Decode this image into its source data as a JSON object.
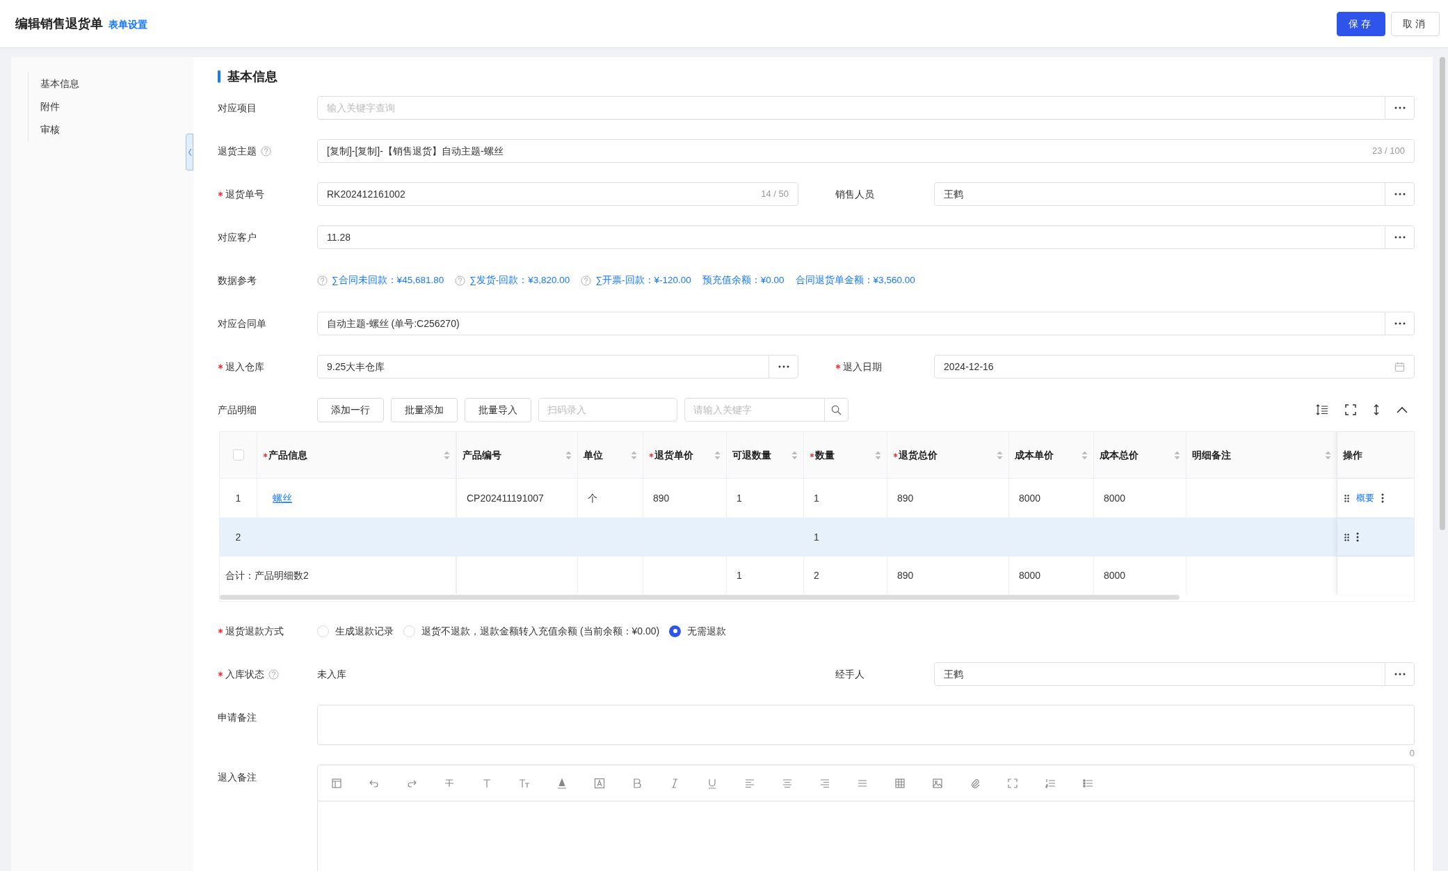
{
  "header": {
    "title": "编辑销售退货单",
    "settings_link": "表单设置",
    "buttons": [
      {
        "label": "保存",
        "kind": "primary"
      },
      {
        "label": "取消",
        "kind": "default"
      }
    ]
  },
  "sidebar": {
    "items": [
      {
        "label": "基本信息"
      },
      {
        "label": "附件"
      },
      {
        "label": "审核"
      }
    ]
  },
  "section": {
    "title": "基本信息"
  },
  "rows": [
    {
      "kind": "picker",
      "label": "对应项目",
      "required": false,
      "help": false,
      "placeholder": "输入关键字查询"
    },
    {
      "kind": "text",
      "label": "退货主题",
      "required": false,
      "help": true,
      "value": "[复制]-[复制]-【销售退货】自动主题-螺丝",
      "counter": "23 / 100"
    },
    {
      "kind": "pair",
      "fields": [
        {
          "kind": "text",
          "label": "退货单号",
          "required": true,
          "help": false,
          "value": "RK202412161002",
          "counter": "14 / 50"
        },
        {
          "kind": "picker",
          "label": "销售人员",
          "required": false,
          "help": false,
          "value": "王鹤"
        }
      ]
    },
    {
      "kind": "picker",
      "label": "对应客户",
      "required": false,
      "help": false,
      "value": "11.28"
    },
    {
      "kind": "refs",
      "label": "数据参考",
      "required": false,
      "help": false,
      "items": [
        {
          "help": true,
          "text": "∑合同未回款：¥45,681.80"
        },
        {
          "help": true,
          "text": "∑发货-回款：¥3,820.00"
        },
        {
          "help": true,
          "text": "∑开票-回款：¥-120.00"
        },
        {
          "help": false,
          "text": "预充值余额：¥0.00"
        },
        {
          "help": false,
          "text": "合同退货单金额：¥3,560.00"
        }
      ]
    },
    {
      "kind": "picker",
      "label": "对应合同单",
      "required": false,
      "help": false,
      "value": "自动主题-螺丝 (单号:C256270)"
    },
    {
      "kind": "pair",
      "fields": [
        {
          "kind": "picker",
          "label": "退入仓库",
          "required": true,
          "help": false,
          "value": "9.25大丰仓库"
        },
        {
          "kind": "date",
          "label": "退入日期",
          "required": true,
          "help": false,
          "value": "2024-12-16"
        }
      ]
    },
    {
      "kind": "products",
      "label": "产品明细",
      "required": false,
      "help": false,
      "buttons": [
        "添加一行",
        "批量添加",
        "批量导入"
      ],
      "scan_placeholder": "扫码录入",
      "search_placeholder": "请输入关键字",
      "table": {
        "all_checked": false,
        "columns": [
          {
            "label": "产品信息",
            "required": true,
            "sortable": true,
            "link": true
          },
          {
            "label": "产品编号",
            "required": false,
            "sortable": true,
            "link": false
          },
          {
            "label": "单位",
            "required": false,
            "sortable": true,
            "link": false
          },
          {
            "label": "退货单价",
            "required": true,
            "sortable": true,
            "link": false
          },
          {
            "label": "可退数量",
            "required": false,
            "sortable": true,
            "link": false
          },
          {
            "label": "数量",
            "required": true,
            "sortable": true,
            "link": false
          },
          {
            "label": "退货总价",
            "required": true,
            "sortable": true,
            "link": false
          },
          {
            "label": "成本单价",
            "required": false,
            "sortable": true,
            "link": false
          },
          {
            "label": "成本总价",
            "required": false,
            "sortable": true,
            "link": false
          },
          {
            "label": "明细备注",
            "required": false,
            "sortable": true,
            "link": false
          },
          {
            "label": "操作",
            "required": false,
            "sortable": false,
            "link": false
          }
        ],
        "rows": [
          {
            "index": "1",
            "selected": false,
            "cells": [
              "螺丝",
              "CP202411191007",
              "个",
              "890",
              "1",
              "1",
              "890",
              "8000",
              "8000",
              null
            ],
            "action_link": "概要"
          },
          {
            "index": "2",
            "selected": true,
            "cells": [
              null,
              null,
              null,
              null,
              null,
              "1",
              null,
              null,
              null,
              null
            ]
          }
        ],
        "totals": {
          "label": "合计：产品明细数2",
          "cells": [
            null,
            null,
            null,
            null,
            "1",
            "2",
            "890",
            "8000",
            "8000",
            null
          ]
        }
      }
    },
    {
      "kind": "radio",
      "label": "退货退款方式",
      "required": true,
      "help": false,
      "options": [
        {
          "label": "生成退款记录",
          "selected": false
        },
        {
          "label": "退货不退款，退款金额转入充值余额 (当前余额：¥0.00)",
          "selected": false
        },
        {
          "label": "无需退款",
          "selected": true
        }
      ]
    },
    {
      "kind": "pair",
      "fields": [
        {
          "kind": "static",
          "label": "入库状态",
          "required": true,
          "help": true,
          "value": "未入库"
        },
        {
          "kind": "picker",
          "label": "经手人",
          "required": false,
          "help": false,
          "value": "王鹤"
        }
      ]
    },
    {
      "kind": "textarea",
      "label": "申请备注",
      "required": false,
      "help": false,
      "counter": "0"
    },
    {
      "kind": "editor",
      "label": "退入备注",
      "required": false,
      "help": false
    }
  ]
}
